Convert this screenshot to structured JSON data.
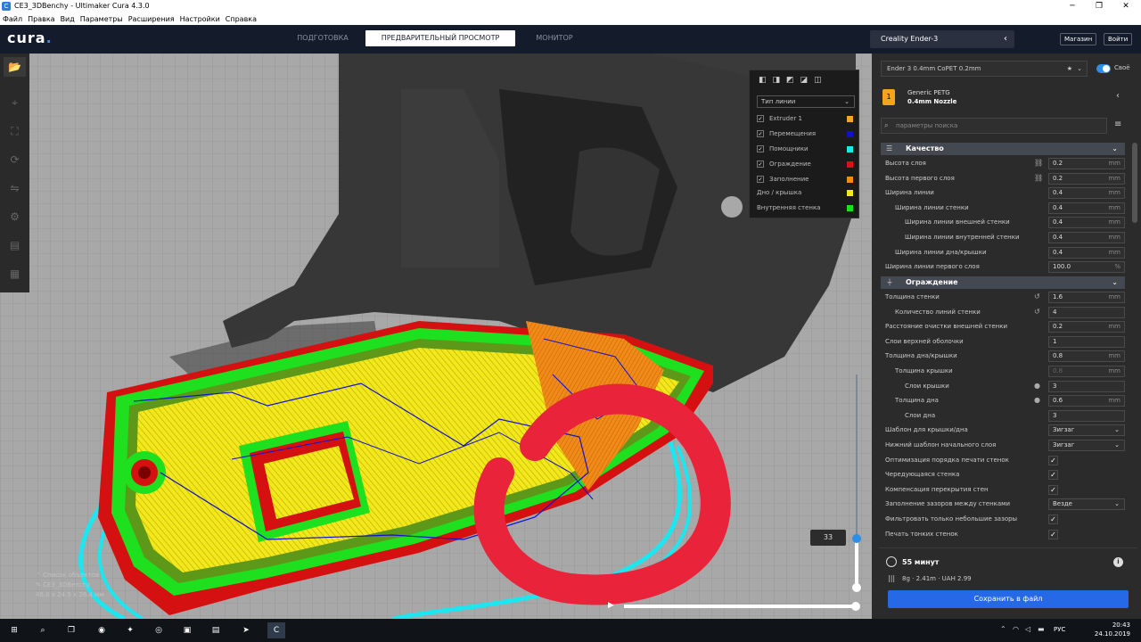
{
  "window": {
    "title": "CE3_3DBenchy - Ultimaker Cura 4.3.0",
    "min": "─",
    "max": "❐",
    "close": "✕"
  },
  "menu": [
    "Файл",
    "Правка",
    "Вид",
    "Параметры",
    "Расширения",
    "Настройки",
    "Справка"
  ],
  "header": {
    "logo": "cura",
    "stages": [
      {
        "label": "ПОДГОТОВКА"
      },
      {
        "label": "ПРЕДВАРИТЕЛЬНЫЙ ПРОСМОТР"
      },
      {
        "label": "МОНИТОР"
      }
    ],
    "printer": "Creality Ender-3",
    "marketplace": "Магазин",
    "signin": "Войти"
  },
  "legend": {
    "dropdown": "Тип линии",
    "items": [
      {
        "label": "Extruder 1",
        "color": "#f5a623",
        "checked": true
      },
      {
        "label": "Перемещения",
        "color": "#1111cc",
        "checked": true
      },
      {
        "label": "Помощники",
        "color": "#1ce6f0",
        "checked": true
      },
      {
        "label": "Ограждение",
        "color": "#dd1111",
        "checked": true
      },
      {
        "label": "Заполнение",
        "color": "#f08a18",
        "checked": true
      },
      {
        "label": "Дно / крышка",
        "color": "#f2e81a",
        "checked": false
      },
      {
        "label": "Внутренняя стенка",
        "color": "#1ee01e",
        "checked": false
      }
    ]
  },
  "layer": {
    "current": "33"
  },
  "object": {
    "list_label": "Список объектов",
    "name": "CE3_3DBenchy",
    "dims": "48.0 x 24.9 x 26.4 мм"
  },
  "panel": {
    "profile": "Ender 3 0.4mm CoPET  0.2mm",
    "custom_label": "Своё",
    "extruder": {
      "number": "1",
      "material": "Generic PETG",
      "nozzle": "0.4mm Nozzle"
    },
    "search_placeholder": "параметры поиска",
    "categories": {
      "quality": "Качество",
      "shell": "Ограждение"
    },
    "quality": [
      {
        "label": "Высота слоя",
        "value": "0.2",
        "unit": "mm",
        "indent": 0,
        "icon": "link-icon"
      },
      {
        "label": "Высота первого слоя",
        "value": "0.2",
        "unit": "mm",
        "indent": 0,
        "icon": "link-icon"
      },
      {
        "label": "Ширина линии",
        "value": "0.4",
        "unit": "mm",
        "indent": 0
      },
      {
        "label": "Ширина линии стенки",
        "value": "0.4",
        "unit": "mm",
        "indent": 1
      },
      {
        "label": "Ширина линии внешней стенки",
        "value": "0.4",
        "unit": "mm",
        "indent": 2
      },
      {
        "label": "Ширина линии внутренней стенки",
        "value": "0.4",
        "unit": "mm",
        "indent": 2
      },
      {
        "label": "Ширина линии дна/крышки",
        "value": "0.4",
        "unit": "mm",
        "indent": 1
      },
      {
        "label": "Ширина линии первого слоя",
        "value": "100.0",
        "unit": "%",
        "indent": 0
      }
    ],
    "shell": [
      {
        "label": "Толщина стенки",
        "value": "1.6",
        "unit": "mm",
        "indent": 0,
        "icon": "reset-icon"
      },
      {
        "label": "Количество линий стенки",
        "value": "4",
        "unit": "",
        "indent": 1,
        "icon": "reset-icon"
      },
      {
        "label": "Расстояние очистки внешней стенки",
        "value": "0.2",
        "unit": "mm",
        "indent": 0
      },
      {
        "label": "Слои верхней оболочки",
        "value": "1",
        "unit": "",
        "indent": 0
      },
      {
        "label": "Толщина дна/крышки",
        "value": "0.8",
        "unit": "mm",
        "indent": 0
      },
      {
        "label": "Толщина крышки",
        "value": "0.8",
        "unit": "mm",
        "indent": 1,
        "disabled": true
      },
      {
        "label": "Слои крышки",
        "value": "3",
        "unit": "",
        "indent": 2,
        "icon": "info-icon"
      },
      {
        "label": "Толщина дна",
        "value": "0.6",
        "unit": "mm",
        "indent": 1,
        "icon": "info-icon"
      },
      {
        "label": "Слои дна",
        "value": "3",
        "unit": "",
        "indent": 2
      },
      {
        "label": "Шаблон для крышки/дна",
        "value": "Зигзаг",
        "type": "dropdown",
        "indent": 0
      },
      {
        "label": "Нижний шаблон начального слоя",
        "value": "Зигзаг",
        "type": "dropdown",
        "indent": 0
      },
      {
        "label": "Оптимизация порядка печати стенок",
        "value": "✓",
        "type": "check",
        "indent": 0
      },
      {
        "label": "Чередующаяся стенка",
        "value": "✓",
        "type": "check",
        "indent": 0
      },
      {
        "label": "Компенсация перекрытия стен",
        "value": "✓",
        "type": "check",
        "indent": 0
      },
      {
        "label": "Заполнение зазоров между стенками",
        "value": "Везде",
        "type": "dropdown",
        "indent": 0
      },
      {
        "label": "Фильтровать только небольшие зазоры",
        "value": "✓",
        "type": "check",
        "indent": 0
      },
      {
        "label": "Печать тонких стенок",
        "value": "✓",
        "type": "check",
        "indent": 0
      }
    ],
    "estimate": {
      "time": "55 минут",
      "material": "8g · 2.41m · UAH 2.99",
      "save": "Сохранить в файл"
    }
  },
  "taskbar": {
    "lang": "РУС",
    "time": "20:43",
    "date": "24.10.2019"
  }
}
